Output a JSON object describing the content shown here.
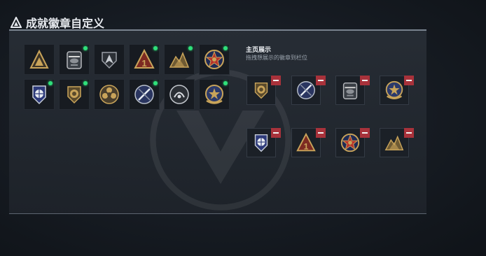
{
  "page": {
    "title": "成就徽章自定义"
  },
  "badges": [
    {
      "id": "pyramid-badge",
      "obtained": false
    },
    {
      "id": "helicopter-badge",
      "obtained": true
    },
    {
      "id": "wings-badge",
      "obtained": false
    },
    {
      "id": "first-place-badge",
      "obtained": true
    },
    {
      "id": "mountain-badge",
      "obtained": true
    },
    {
      "id": "star-medal-badge",
      "obtained": true
    },
    {
      "id": "shield-globe-badge",
      "obtained": true
    },
    {
      "id": "lion-badge",
      "obtained": true
    },
    {
      "id": "flower-badge",
      "obtained": false
    },
    {
      "id": "sword-crest-badge",
      "obtained": true
    },
    {
      "id": "emblem-badge",
      "obtained": false
    },
    {
      "id": "gold-crest-badge",
      "obtained": true
    }
  ],
  "showcase": {
    "title": "主页展示",
    "subtitle": "拖拽想展示的徽章到栏位",
    "slots": [
      "lion-badge",
      "sword-crest-badge",
      "helicopter-badge",
      "gold-crest-badge",
      "shield-globe-badge",
      "first-place-badge",
      "star-medal-badge",
      "mountain-badge"
    ]
  },
  "colors": {
    "accent_green": "#2fe07a",
    "remove_red": "#a8323b",
    "gold": "#c9a45a"
  }
}
